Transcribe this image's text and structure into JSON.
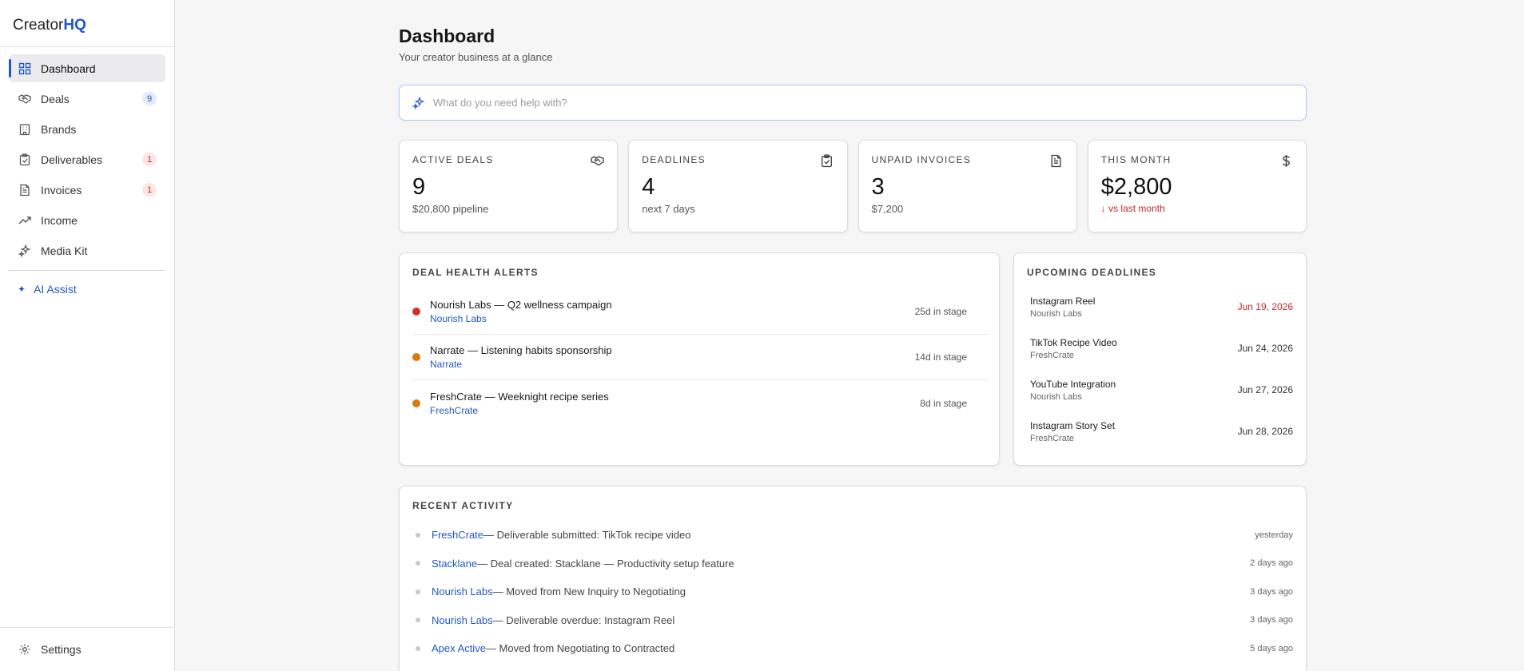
{
  "brand": {
    "name_prefix": "Creator",
    "name_suffix": "HQ"
  },
  "colors": {
    "accent": "#2158c4",
    "danger": "#c62828",
    "warning": "#d97a0a",
    "background": "#f6f6f7"
  },
  "sidebar": {
    "items": [
      {
        "label": "Dashboard",
        "icon": "grid-icon",
        "active": true,
        "badge": ""
      },
      {
        "label": "Deals",
        "icon": "handshake-icon",
        "badge": "9"
      },
      {
        "label": "Brands",
        "icon": "building-icon",
        "badge": ""
      },
      {
        "label": "Deliverables",
        "icon": "clipboard-check-icon",
        "badge": "1"
      },
      {
        "label": "Invoices",
        "icon": "document-icon",
        "badge": "1"
      },
      {
        "label": "Income",
        "icon": "trending-up-icon",
        "badge": ""
      },
      {
        "label": "Media Kit",
        "icon": "sparkles-icon",
        "badge": ""
      }
    ],
    "ai_assist": "AI Assist",
    "settings": "Settings"
  },
  "header": {
    "title": "Dashboard",
    "subtitle": "Your creator business at a glance"
  },
  "search": {
    "placeholder": "What do you need help with?",
    "value": ""
  },
  "stats": [
    {
      "label": "ACTIVE DEALS",
      "value": "9",
      "sub": "$20,800 pipeline",
      "icon": "handshake-icon"
    },
    {
      "label": "DEADLINES",
      "value": "4",
      "sub": "next 7 days",
      "icon": "clipboard-check-icon"
    },
    {
      "label": "UNPAID INVOICES",
      "value": "3",
      "sub": "$7,200",
      "icon": "document-icon"
    },
    {
      "label": "THIS MONTH",
      "value": "$2,800",
      "sub": "↓ vs last month",
      "icon": "dollar-icon"
    }
  ],
  "alerts": {
    "title": "DEAL HEALTH ALERTS",
    "rows": [
      {
        "name": "Nourish Labs — Q2 wellness campaign",
        "brand": "Nourish Labs",
        "stage": "25d in stage",
        "severity": "high"
      },
      {
        "name": "Narrate — Listening habits sponsorship",
        "brand": "Narrate",
        "stage": "14d in stage",
        "severity": "medium"
      },
      {
        "name": "FreshCrate — Weeknight recipe series",
        "brand": "FreshCrate",
        "stage": "8d in stage",
        "severity": "medium"
      }
    ]
  },
  "deadlines": {
    "title": "UPCOMING DEADLINES",
    "rows": [
      {
        "name": "Instagram Reel",
        "brand": "Nourish Labs",
        "date": "Jun 19, 2026",
        "overdue": true
      },
      {
        "name": "TikTok Recipe Video",
        "brand": "FreshCrate",
        "date": "Jun 24, 2026",
        "overdue": false
      },
      {
        "name": "YouTube Integration",
        "brand": "Nourish Labs",
        "date": "Jun 27, 2026",
        "overdue": false
      },
      {
        "name": "Instagram Story Set",
        "brand": "FreshCrate",
        "date": "Jun 28, 2026",
        "overdue": false
      }
    ]
  },
  "activity": {
    "title": "RECENT ACTIVITY",
    "rows": [
      {
        "brand": "FreshCrate",
        "text": " — Deliverable submitted: TikTok recipe video",
        "time": "yesterday"
      },
      {
        "brand": "Stacklane",
        "text": " — Deal created: Stacklane — Productivity setup feature",
        "time": "2 days ago"
      },
      {
        "brand": "Nourish Labs",
        "text": " — Moved from New Inquiry to Negotiating",
        "time": "3 days ago"
      },
      {
        "brand": "Nourish Labs",
        "text": " — Deliverable overdue: Instagram Reel",
        "time": "3 days ago"
      },
      {
        "brand": "Apex Active",
        "text": " — Moved from Negotiating to Contracted",
        "time": "5 days ago"
      }
    ]
  }
}
